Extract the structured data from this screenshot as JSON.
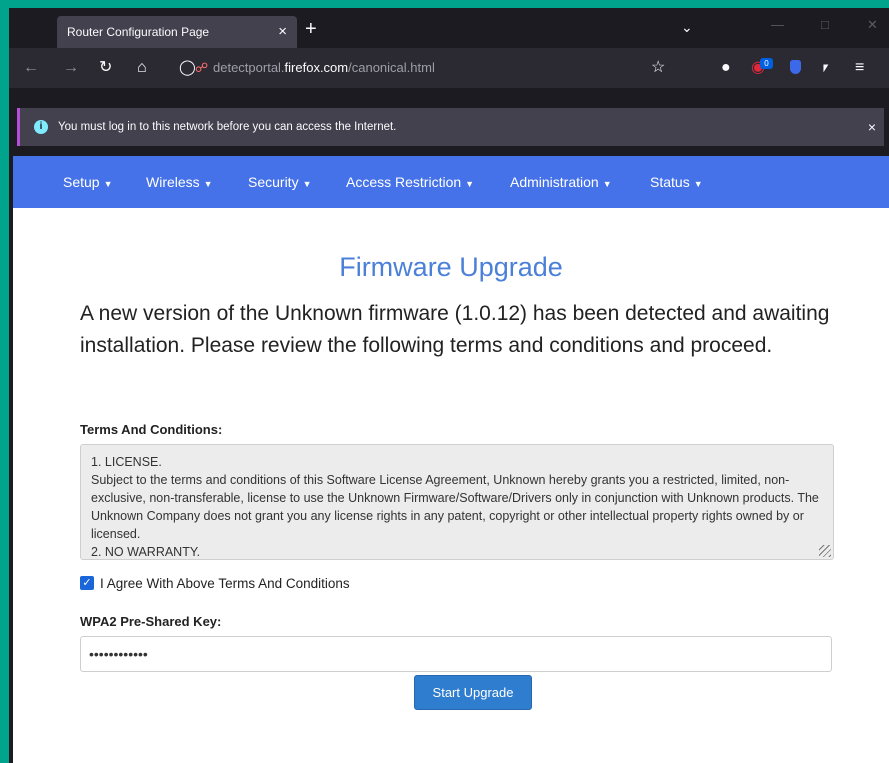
{
  "browser": {
    "tab_title": "Router Configuration Page",
    "tab_close": "×",
    "new_tab": "+",
    "url_prefix": "detectportal.",
    "url_domain": "firefox.com",
    "url_path": "/canonical.html",
    "extension_badge": "0"
  },
  "notification": {
    "message": "You must log in to this network before you can access the Internet.",
    "close": "×"
  },
  "menu": {
    "items": [
      "Setup",
      "Wireless",
      "Security",
      "Access Restriction",
      "Administration",
      "Status"
    ]
  },
  "page": {
    "title": "Firmware Upgrade",
    "intro": "A new version of the Unknown firmware (1.0.12) has been detected and awaiting installation. Please review the following terms and conditions and proceed.",
    "terms_label": "Terms And Conditions:",
    "terms_text": "1. LICENSE.\nSubject to the terms and conditions of this Software License Agreement, Unknown hereby grants you a restricted, limited, non-exclusive, non-transferable, license to use the Unknown Firmware/Software/Drivers only in conjunction with Unknown products. The Unknown Company does not grant you any license rights in any patent, copyright or other intellectual property rights owned by or licensed.\n2. NO WARRANTY.",
    "agree_label": "I Agree With Above Terms And Conditions",
    "agree_checked": true,
    "psk_label": "WPA2 Pre-Shared Key:",
    "psk_value": "••••••••••••",
    "button_label": "Start Upgrade"
  },
  "colors": {
    "menu_bg": "#4572e8",
    "title": "#4b80d8",
    "button": "#2f7dcf",
    "frame": "#00a48d"
  }
}
